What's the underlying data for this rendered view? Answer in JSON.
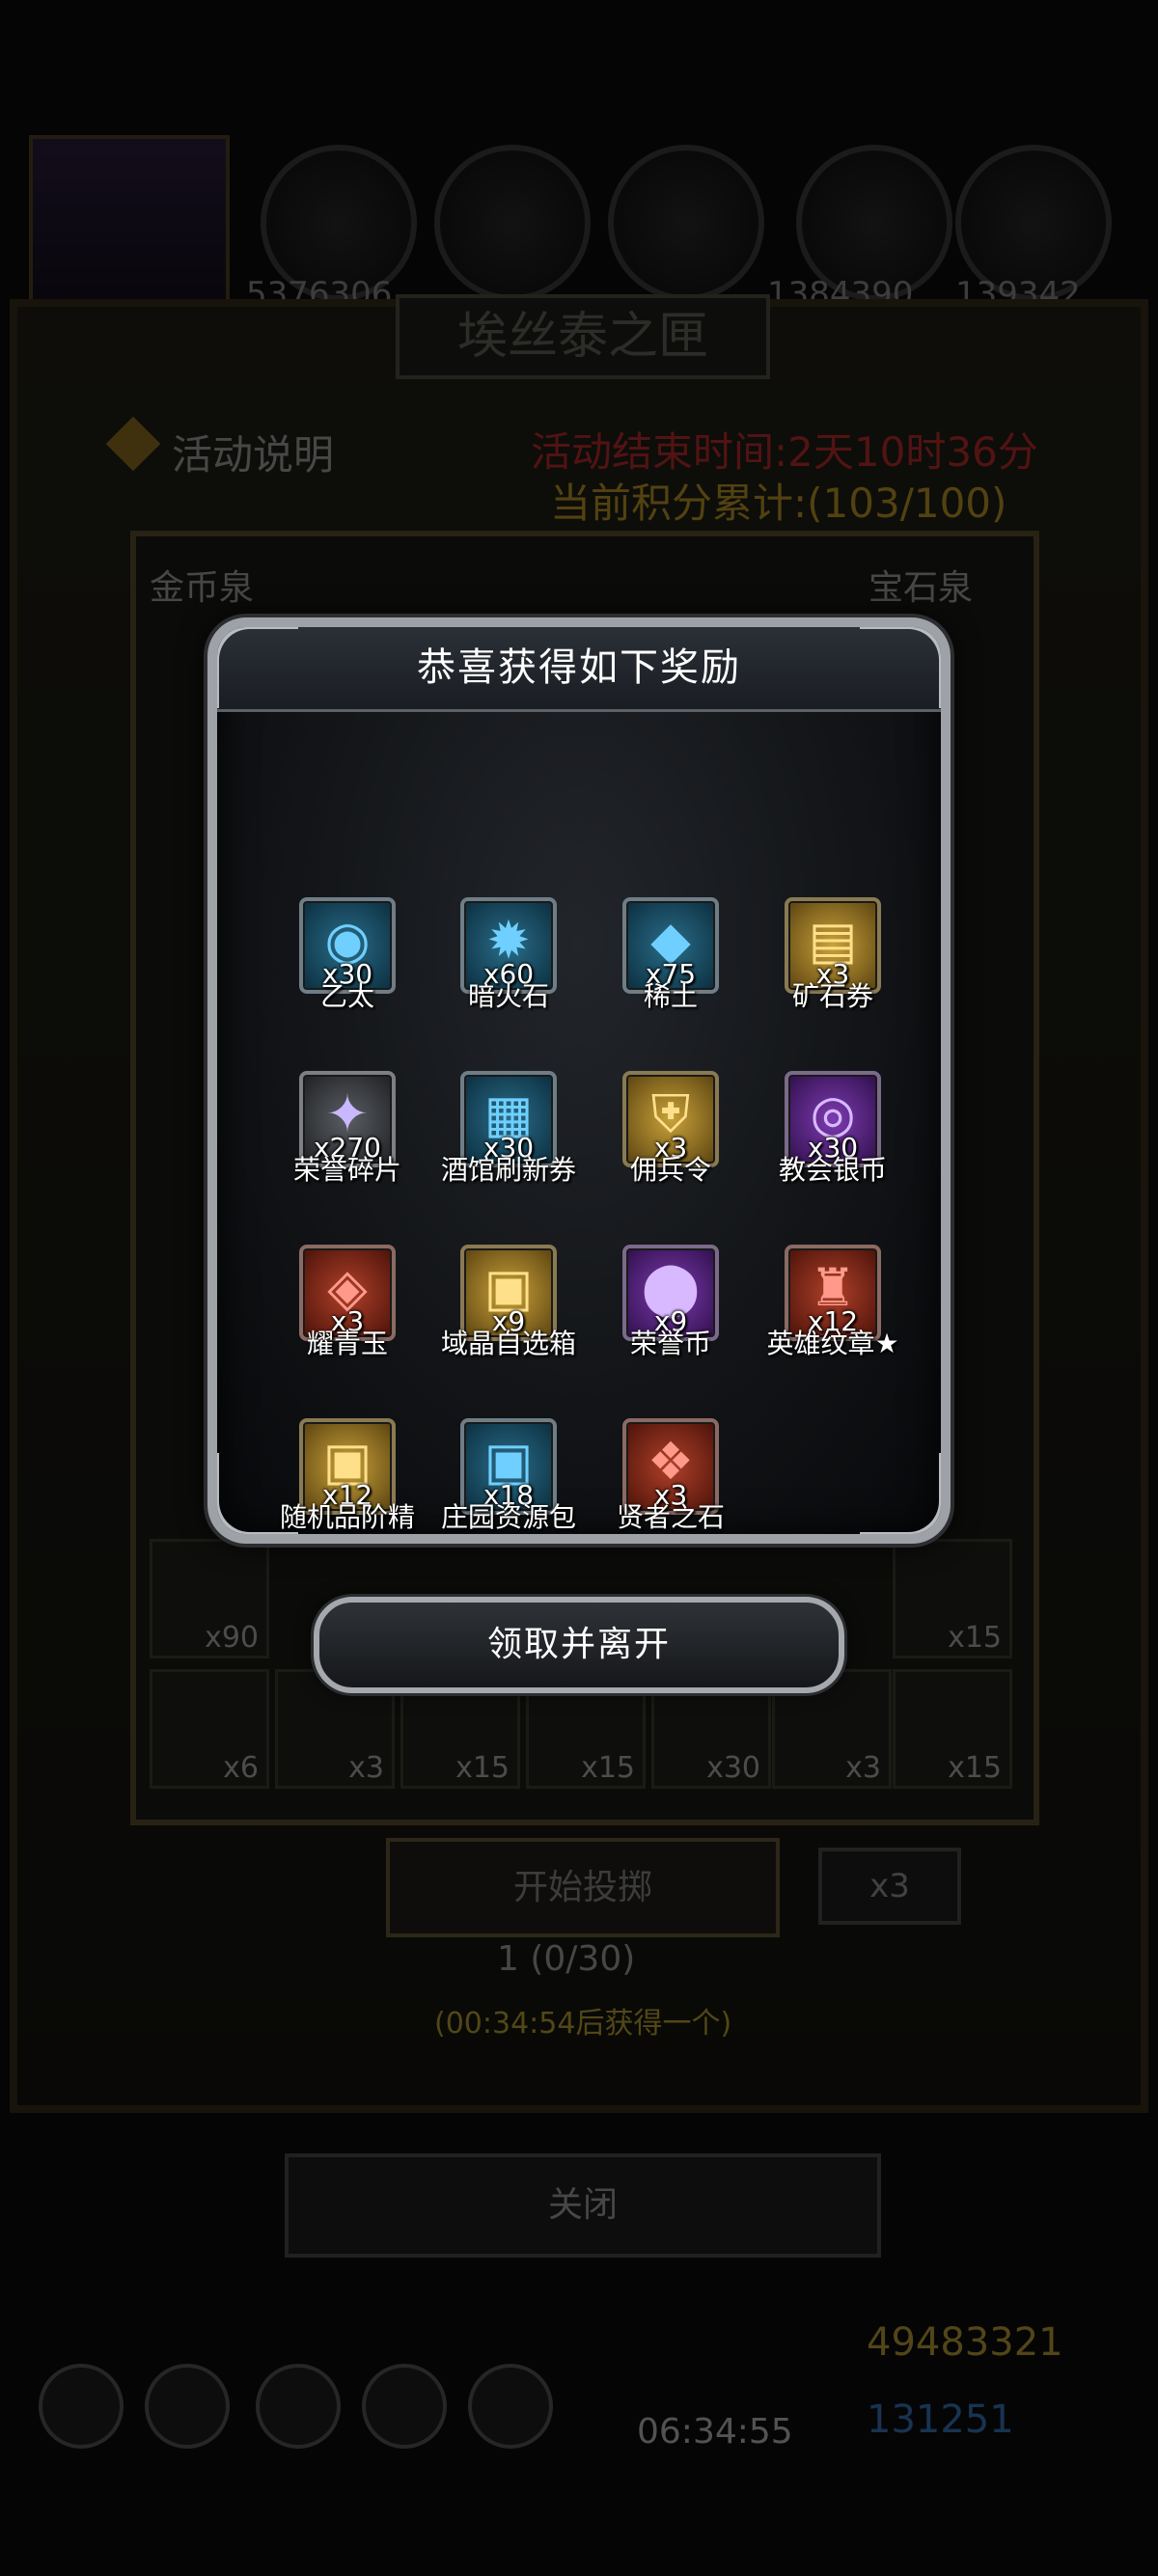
{
  "background": {
    "top_resources": [
      "5376306",
      "1384390",
      "139342"
    ],
    "panel_title": "埃丝泰之匣",
    "activity_note": "活动说明",
    "activity_end": "活动结束时间:2天10时36分",
    "score": "当前积分累计:(103/100)",
    "board_left_label": "金币泉",
    "board_right_label": "宝石泉",
    "board_bottom_row": [
      "x90",
      "x15",
      "x6",
      "x3",
      "x15",
      "x15",
      "x30",
      "x3",
      "x15"
    ],
    "roll_button": "开始投掷",
    "roll_multiplier": "x3",
    "roll_count": "1 (0/30)",
    "roll_hint": "(00:34:54后获得一个)",
    "close_button": "关闭",
    "gold": "49483321",
    "gems": "131251",
    "timer": "06:34:55"
  },
  "modal": {
    "title": "恭喜获得如下奖励",
    "claim_button": "领取并离开",
    "items": [
      {
        "name": "乙太",
        "qty": "x30",
        "icon": "ether-orb-icon",
        "color": "blue",
        "glyph": "◉"
      },
      {
        "name": "暗火石",
        "qty": "x60",
        "icon": "dark-fire-stone-icon",
        "color": "blue",
        "glyph": "✹"
      },
      {
        "name": "稀土",
        "qty": "x75",
        "icon": "rare-earth-icon",
        "color": "blue",
        "glyph": "◆"
      },
      {
        "name": "矿石券",
        "qty": "x3",
        "icon": "ore-ticket-icon",
        "color": "gold",
        "glyph": "▤"
      },
      {
        "name": "荣誉碎片",
        "qty": "x270",
        "icon": "honor-shard-icon",
        "color": "gray",
        "glyph": "✦"
      },
      {
        "name": "酒馆刷新券",
        "qty": "x30",
        "icon": "tavern-refresh-ticket-icon",
        "color": "blue",
        "glyph": "▦"
      },
      {
        "name": "佣兵令",
        "qty": "x3",
        "icon": "mercenary-token-icon",
        "color": "gold",
        "glyph": "⛨"
      },
      {
        "name": "教会银币",
        "qty": "x30",
        "icon": "church-silver-coin-icon",
        "color": "purple",
        "glyph": "◎"
      },
      {
        "name": "耀青玉",
        "qty": "x3",
        "icon": "jade-crystal-icon",
        "color": "red",
        "glyph": "◈"
      },
      {
        "name": "域晶自选箱",
        "qty": "x9",
        "icon": "crystal-chest-icon",
        "color": "gold",
        "glyph": "▣"
      },
      {
        "name": "荣誉币",
        "qty": "x9",
        "icon": "honor-coin-icon",
        "color": "purple",
        "glyph": "⬤"
      },
      {
        "name": "英雄纹章★",
        "qty": "x12",
        "icon": "hero-emblem-icon",
        "color": "red",
        "glyph": "♜"
      },
      {
        "name": "随机品阶精",
        "qty": "x12",
        "icon": "random-chest-icon",
        "color": "gold",
        "glyph": "▣"
      },
      {
        "name": "庄园资源包",
        "qty": "x18",
        "icon": "manor-resource-chest-icon",
        "color": "blue",
        "glyph": "▣"
      },
      {
        "name": "贤者之石",
        "qty": "x3",
        "icon": "sage-stone-icon",
        "color": "red",
        "glyph": "❖"
      }
    ]
  }
}
